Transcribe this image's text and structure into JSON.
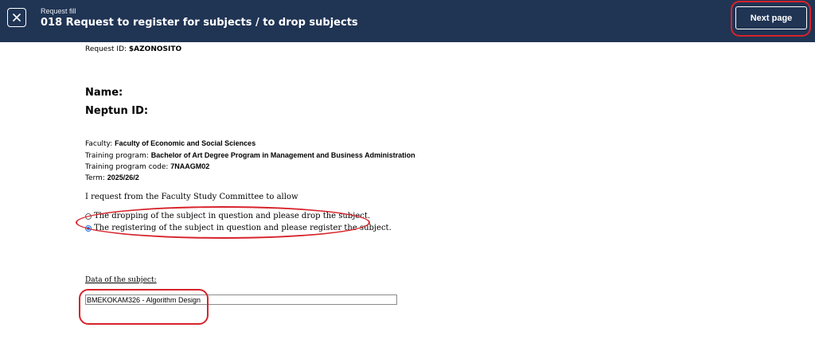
{
  "header": {
    "subtitle": "Request fill",
    "title": "018 Request to register for subjects / to drop subjects",
    "next_label": "Next page"
  },
  "form": {
    "request_id_label": "Request ID:",
    "request_id_value": "$AZONOSITO",
    "name_label": "Name:",
    "neptun_label": "Neptun ID:",
    "faculty_label": "Faculty:",
    "faculty_value": "Faculty of Economic and Social Sciences",
    "program_label": "Training program:",
    "program_value": "Bachelor of Art Degree Program in Management and Business Administration",
    "program_code_label": "Training program code:",
    "program_code_value": "7NAAGM02",
    "term_label": "Term:",
    "term_value": "2025/26/2",
    "request_text": "I request from the Faculty Study Committee to allow",
    "options": [
      {
        "label": "The dropping of the subject in question and please drop the subject.",
        "checked": false
      },
      {
        "label": "The registering of the subject in question and please register the subject.",
        "checked": true
      }
    ],
    "subject_section_label": "Data of the subject:",
    "subject_value": "BMEKOKAM326 - Algorithm Design"
  },
  "colors": {
    "header_bg": "#203454",
    "annotation": "#d7232b"
  }
}
